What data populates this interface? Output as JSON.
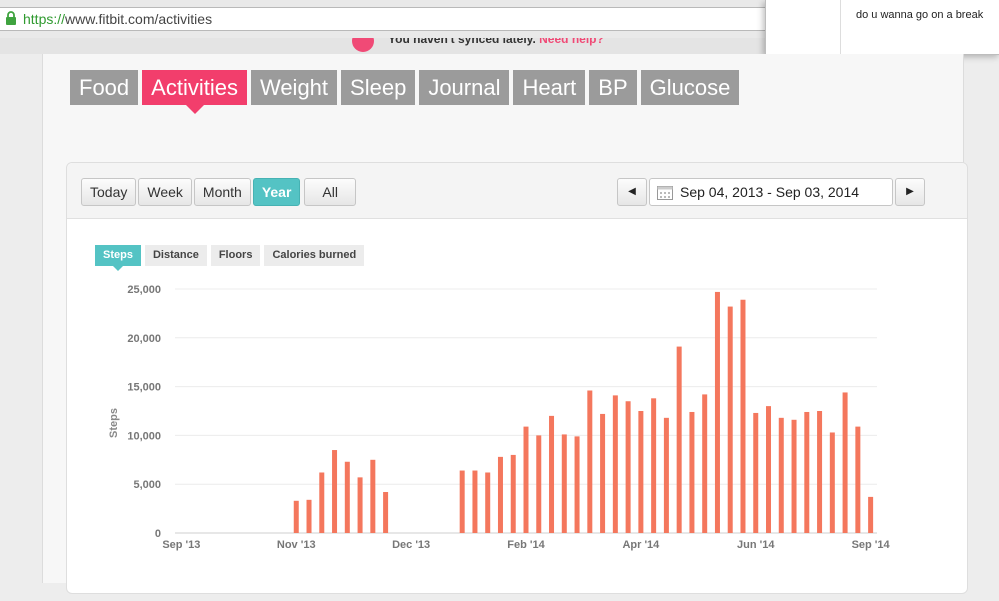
{
  "browser": {
    "url_scheme": "https://",
    "url_rest": "www.fitbit.com/activities"
  },
  "notice": {
    "text": "You haven't synced lately.",
    "link": "Need help?"
  },
  "chat": {
    "message": "do u wanna go on a break"
  },
  "nav_tabs": [
    {
      "label": "Food"
    },
    {
      "label": "Activities"
    },
    {
      "label": "Weight"
    },
    {
      "label": "Sleep"
    },
    {
      "label": "Journal"
    },
    {
      "label": "Heart"
    },
    {
      "label": "BP"
    },
    {
      "label": "Glucose"
    }
  ],
  "active_nav_tab": "Activities",
  "range_buttons": [
    "Today",
    "Week",
    "Month",
    "Year",
    "All"
  ],
  "active_range": "Year",
  "date_range": "Sep 04, 2013 - Sep 03, 2014",
  "metric_tabs": [
    "Steps",
    "Distance",
    "Floors",
    "Calories burned"
  ],
  "active_metric": "Steps",
  "colors": {
    "brand_pink": "#f23e6c",
    "accent_teal": "#54c3c4",
    "bar": "#f4775d",
    "tab_gray": "#9b9b9b"
  },
  "chart_data": {
    "type": "bar",
    "ylabel": "Steps",
    "ylim": [
      0,
      25000
    ],
    "yticks": [
      0,
      5000,
      10000,
      15000,
      20000,
      25000
    ],
    "ytick_labels": [
      "0",
      "5,000",
      "10,000",
      "15,000",
      "20,000",
      "25,000"
    ],
    "xtick_labels": [
      "Sep '13",
      "Nov '13",
      "Dec '13",
      "Feb '14",
      "Apr '14",
      "Jun '14",
      "Sep '14"
    ],
    "xtick_weeks": [
      0,
      9,
      18,
      27,
      36,
      45,
      54
    ],
    "grid": true,
    "series": [
      {
        "values": [
          0,
          0,
          0,
          0,
          0,
          0,
          0,
          0,
          0,
          3300,
          3400,
          6200,
          8500,
          7300,
          5700,
          7500,
          4200,
          0,
          0,
          0,
          0,
          0,
          6400,
          6400,
          6200,
          7800,
          8000,
          10900,
          10000,
          12000,
          10100,
          9900,
          14600,
          12200,
          14100,
          13500,
          12500,
          13800,
          11800,
          19100,
          12400,
          14200,
          24700,
          23200,
          23900,
          12300,
          13000,
          11800,
          11600,
          12400,
          12500,
          10300,
          14400,
          10900,
          3700
        ]
      }
    ]
  }
}
